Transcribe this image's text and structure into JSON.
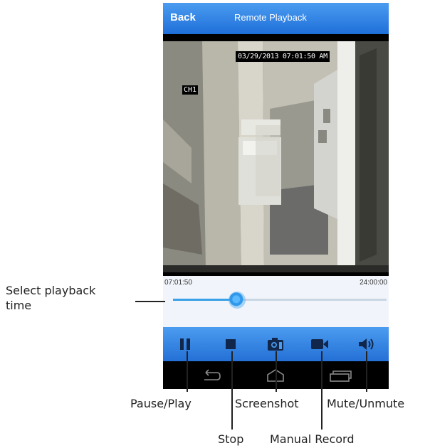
{
  "header": {
    "back_label": "Back",
    "title": "Remote Playback"
  },
  "video": {
    "timestamp": "03/29/2013 07:01:50 AM",
    "channel": "CH1"
  },
  "playback": {
    "current_time": "07:01:50",
    "end_time": "24:00:00",
    "position_fraction": 0.3,
    "accent": "#3aa0e8"
  },
  "toolbar": {
    "color": "#2f80e0"
  },
  "callouts": {
    "select_time": [
      "Select playback",
      "time"
    ],
    "pause_play": "Pause/Play",
    "stop": "Stop",
    "screenshot": "Screenshot",
    "manual_record": "Manual Record",
    "mute_unmute": "Mute/Unmute"
  },
  "icons": {
    "pause": "pause-icon",
    "stop": "stop-icon",
    "screenshot": "camera-icon",
    "record": "video-camera-icon",
    "mute": "speaker-icon",
    "nav_back": "back-arrow-icon",
    "nav_home": "home-icon",
    "nav_recent": "recent-apps-icon"
  }
}
